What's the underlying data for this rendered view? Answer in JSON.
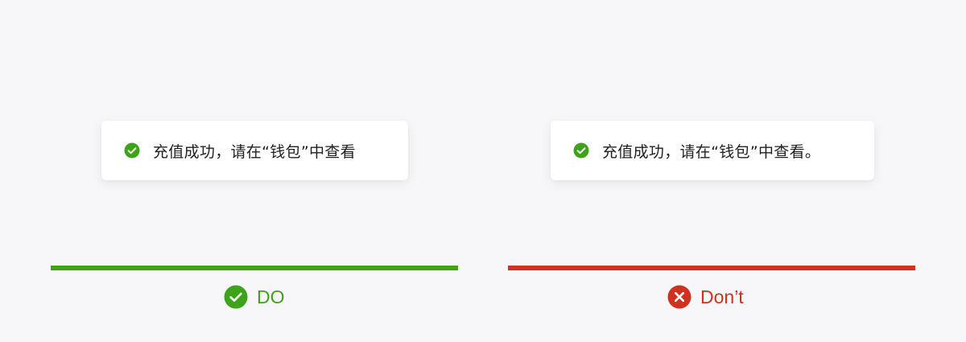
{
  "colors": {
    "background": "#f7f7f9",
    "do": "#3da41a",
    "dont": "#d0321f",
    "toast_bg": "#ffffff",
    "toast_text": "#1f1f1f"
  },
  "examples": [
    {
      "toast": {
        "icon": "check-circle-icon",
        "message": "充值成功，请在“钱包”中查看"
      },
      "verdict": {
        "icon": "check-circle-icon",
        "label": "DO",
        "color": "#3da41a"
      }
    },
    {
      "toast": {
        "icon": "check-circle-icon",
        "message": "充值成功，请在“钱包”中查看。"
      },
      "verdict": {
        "icon": "x-circle-icon",
        "label": "Don’t",
        "color": "#d0321f"
      }
    }
  ]
}
